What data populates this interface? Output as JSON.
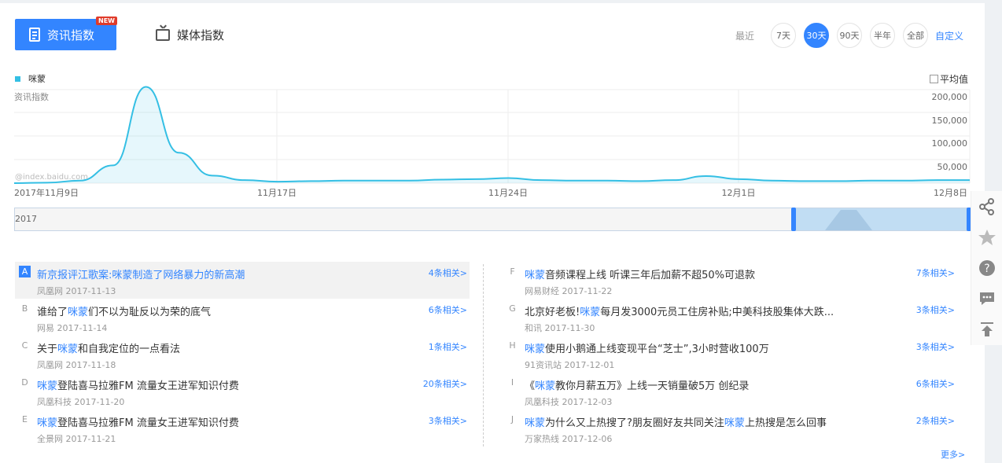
{
  "tabs": {
    "news_index": "资讯指数",
    "new_badge": "NEW",
    "media_index": "媒体指数"
  },
  "range": {
    "label": "最近",
    "options": [
      "7天",
      "30天",
      "90天",
      "半年",
      "全部"
    ],
    "selected": "30天",
    "custom": "自定义"
  },
  "chart_data": {
    "type": "area",
    "series": [
      {
        "name": "咪蒙",
        "color": "#34bfe4"
      }
    ],
    "ylabel": "资讯指数",
    "ylim": [
      0,
      200000
    ],
    "y_ticks": [
      "200,000",
      "150,000",
      "100,000",
      "50,000"
    ],
    "x_ticks": [
      "2017年11月9日",
      "11月17日",
      "11月24日",
      "12月1日",
      "12月8日"
    ],
    "watermark": "@index.baidu.com",
    "x_dates": [
      "11-09",
      "11-10",
      "11-11",
      "11-12",
      "11-13",
      "11-14",
      "11-15",
      "11-16",
      "11-17",
      "11-18",
      "11-19",
      "11-20",
      "11-21",
      "11-22",
      "11-23",
      "11-24",
      "11-25",
      "11-26",
      "11-27",
      "11-28",
      "11-29",
      "11-30",
      "12-01",
      "12-02",
      "12-03",
      "12-04",
      "12-05",
      "12-06",
      "12-07",
      "12-08"
    ],
    "values": [
      0,
      1000,
      5000,
      35000,
      190000,
      60000,
      15000,
      6000,
      3000,
      4000,
      5000,
      5000,
      5000,
      7000,
      8000,
      10000,
      6000,
      5000,
      5000,
      4000,
      6000,
      14000,
      8000,
      5000,
      4000,
      4000,
      5000,
      5000,
      6000,
      6000
    ],
    "grid": true,
    "average_toggle_label": "平均值",
    "average_checked": false
  },
  "slider": {
    "year": "2017"
  },
  "news_left": [
    {
      "letter": "A",
      "title_parts": [
        {
          "t": "新京报评江歌案:咪蒙制造了网络暴力的新高潮",
          "kw": false
        }
      ],
      "source": "凤凰网 2017-11-13",
      "related": "4条相关>",
      "active": true
    },
    {
      "letter": "B",
      "title_parts": [
        {
          "t": "谁给了",
          "kw": false
        },
        {
          "t": "咪蒙",
          "kw": true
        },
        {
          "t": "们不以为耻反以为荣的底气",
          "kw": false
        }
      ],
      "source": "网易 2017-11-14",
      "related": "6条相关>",
      "active": false
    },
    {
      "letter": "C",
      "title_parts": [
        {
          "t": "关于",
          "kw": false
        },
        {
          "t": "咪蒙",
          "kw": true
        },
        {
          "t": "和自我定位的一点看法",
          "kw": false
        }
      ],
      "source": "凤凰网 2017-11-18",
      "related": "1条相关>",
      "active": false
    },
    {
      "letter": "D",
      "title_parts": [
        {
          "t": "咪蒙",
          "kw": true
        },
        {
          "t": "登陆喜马拉雅FM 流量女王进军知识付费",
          "kw": false
        }
      ],
      "source": "凤凰科技 2017-11-20",
      "related": "20条相关>",
      "active": false
    },
    {
      "letter": "E",
      "title_parts": [
        {
          "t": "咪蒙",
          "kw": true
        },
        {
          "t": "登陆喜马拉雅FM 流量女王进军知识付费",
          "kw": false
        }
      ],
      "source": "全景网 2017-11-21",
      "related": "3条相关>",
      "active": false
    }
  ],
  "news_right": [
    {
      "letter": "F",
      "title_parts": [
        {
          "t": "咪蒙",
          "kw": true
        },
        {
          "t": "音频课程上线 听课三年后加薪不超50%可退款",
          "kw": false
        }
      ],
      "source": "网易财经 2017-11-22",
      "related": "7条相关>",
      "active": false
    },
    {
      "letter": "G",
      "title_parts": [
        {
          "t": "北京好老板!",
          "kw": false
        },
        {
          "t": "咪蒙",
          "kw": true
        },
        {
          "t": "每月发3000元员工住房补贴;中美科技股集体大跌...",
          "kw": false
        }
      ],
      "source": "和讯 2017-11-30",
      "related": "3条相关>",
      "active": false
    },
    {
      "letter": "H",
      "title_parts": [
        {
          "t": "咪蒙",
          "kw": true
        },
        {
          "t": "使用小鹅通上线变现平台“芝士”,3小时营收100万",
          "kw": false
        }
      ],
      "source": "91资讯站 2017-12-01",
      "related": "3条相关>",
      "active": false
    },
    {
      "letter": "I",
      "title_parts": [
        {
          "t": "《",
          "kw": false
        },
        {
          "t": "咪蒙",
          "kw": true
        },
        {
          "t": "教你月薪五万》上线一天销量破5万 创纪录",
          "kw": false
        }
      ],
      "source": "凤凰科技 2017-12-03",
      "related": "6条相关>",
      "active": false
    },
    {
      "letter": "J",
      "title_parts": [
        {
          "t": "咪蒙",
          "kw": true
        },
        {
          "t": "为什么又上热搜了?朋友圈好友共同关注",
          "kw": false
        },
        {
          "t": "咪蒙",
          "kw": true
        },
        {
          "t": "上热搜是怎么回事",
          "kw": false
        }
      ],
      "source": "万家热线 2017-12-06",
      "related": "2条相关>",
      "active": false
    }
  ],
  "more": "更多>"
}
